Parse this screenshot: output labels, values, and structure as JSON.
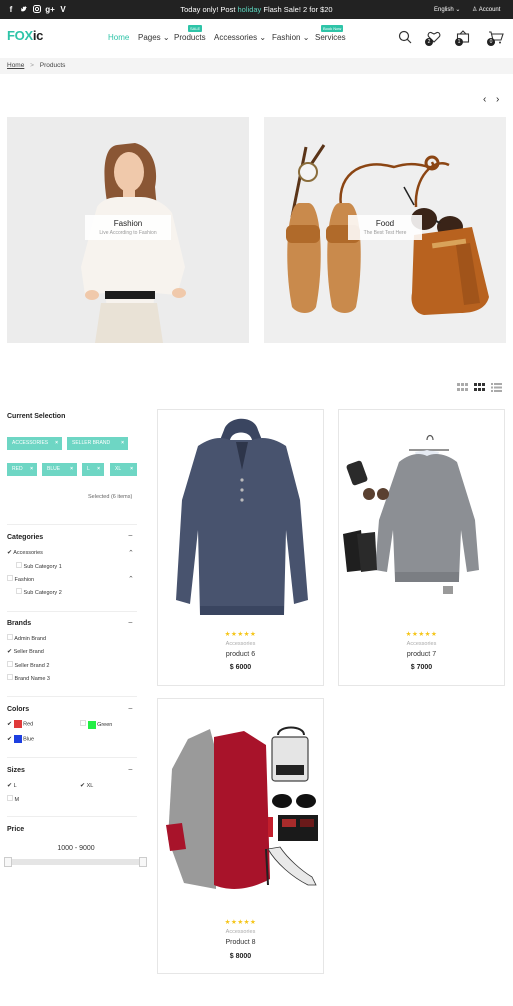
{
  "topbar": {
    "promo_pre": "Today only! Post ",
    "promo_hl": "holiday",
    "promo_post": " Flash Sale! 2 for $20",
    "language": "English",
    "account": "Account",
    "social": [
      "facebook-icon",
      "twitter-icon",
      "instagram-icon",
      "googleplus-icon",
      "vimeo-icon"
    ]
  },
  "header": {
    "logo_a": "FOX",
    "logo_b": "ic",
    "nav": [
      {
        "label": "Home",
        "active": true
      },
      {
        "label": "Pages",
        "caret": true
      },
      {
        "label": "Products",
        "badge": "SALE"
      },
      {
        "label": "Accessories",
        "caret": true
      },
      {
        "label": "Fashion",
        "caret": true
      },
      {
        "label": "Services",
        "badge": "Book Now"
      }
    ],
    "wishlist_count": "2",
    "compare_count": "1",
    "cart_count": "0",
    "accent": "#2ec4a8"
  },
  "breadcrumb": {
    "home": "Home",
    "sep": ">",
    "current": "Products"
  },
  "banners": [
    {
      "title": "Fashion",
      "subtitle": "Live According to Fashion"
    },
    {
      "title": "Food",
      "subtitle": "The Best Test Here"
    }
  ],
  "sidebar": {
    "current_selection": "Current Selection",
    "tags": [
      "ACCESSORIES",
      "SELLER BRAND",
      "RED",
      "BLUE",
      "L",
      "XL"
    ],
    "selected_text": "Selected",
    "selected_count": "(6 items)",
    "categories_title": "Categories",
    "categories": [
      {
        "label": "Accessories",
        "checked": true
      },
      {
        "label": "Sub Category 1",
        "checked": false
      },
      {
        "label": "Fashion",
        "checked": false
      },
      {
        "label": "Sub Category 2",
        "checked": false
      }
    ],
    "brands_title": "Brands",
    "brands": [
      {
        "label": "Admin Brand",
        "checked": false
      },
      {
        "label": "Seller Brand",
        "checked": true
      },
      {
        "label": "Seller Brand 2",
        "checked": false
      },
      {
        "label": "Brand Name 3",
        "checked": false
      }
    ],
    "colors_title": "Colors",
    "colors": [
      {
        "label": "Red",
        "hex": "#e03a3a",
        "checked": true
      },
      {
        "label": "Green",
        "hex": "#22ee44",
        "checked": false
      },
      {
        "label": "Blue",
        "hex": "#1d3fe0",
        "checked": true
      }
    ],
    "sizes_title": "Sizes",
    "sizes": [
      {
        "label": "L",
        "checked": true
      },
      {
        "label": "XL",
        "checked": true
      },
      {
        "label": "M",
        "checked": false
      }
    ],
    "price_title": "Price",
    "price_range": "1000 - 9000"
  },
  "products": [
    {
      "category": "Accessories",
      "name": "product 6",
      "price": "$ 6000",
      "rating": 5
    },
    {
      "category": "Accessories",
      "name": "product 7",
      "price": "$ 7000",
      "rating": 5
    },
    {
      "category": "Accessories",
      "name": "Product 8",
      "price": "$ 8000",
      "rating": 5
    }
  ]
}
